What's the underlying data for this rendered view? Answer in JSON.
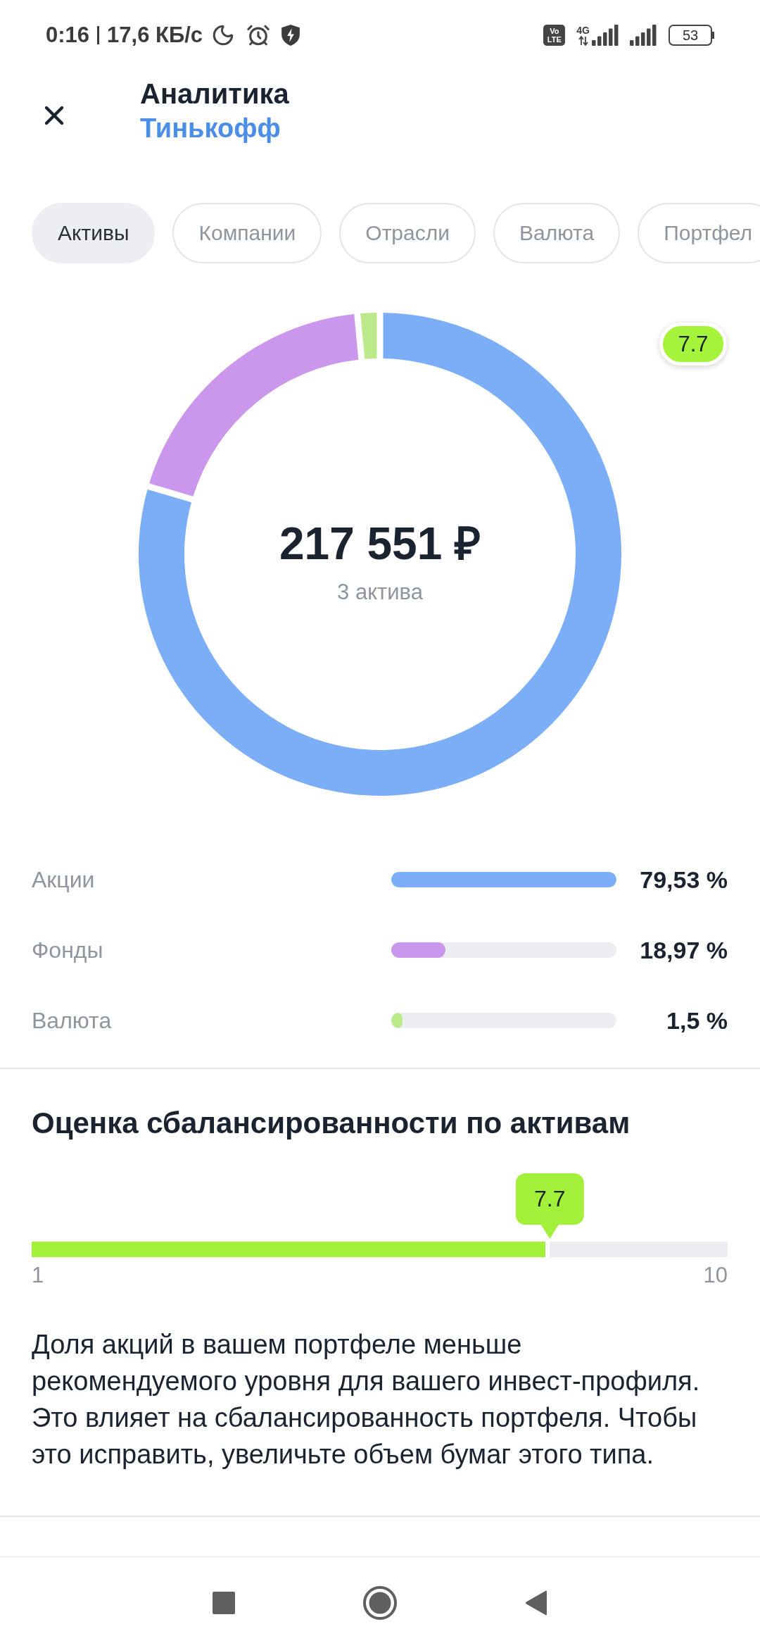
{
  "status_bar": {
    "time": "0:16",
    "speed": "17,6 КБ/с",
    "volte": "Vo LTE",
    "network": "4G",
    "battery": "53"
  },
  "header": {
    "title": "Аналитика",
    "subtitle": "Тинькофф"
  },
  "tabs": [
    {
      "label": "Активы",
      "selected": true
    },
    {
      "label": "Компании",
      "selected": false
    },
    {
      "label": "Отрасли",
      "selected": false
    },
    {
      "label": "Валюта",
      "selected": false
    },
    {
      "label": "Портфел",
      "selected": false
    }
  ],
  "summary": {
    "score_badge": "7.7",
    "total": "217 551 ₽",
    "caption": "3 актива",
    "chart_data": {
      "type": "donut",
      "categories": [
        "Акции",
        "Фонды",
        "Валюта"
      ],
      "values": [
        79.53,
        18.97,
        1.5
      ]
    }
  },
  "assets": [
    {
      "percent": "79,53 %",
      "level": 1,
      "color": "#7caef8"
    },
    {
      "percent": "18,97 %",
      "level": 0.24,
      "color": "#cb97ec"
    },
    {
      "percent": "1,5 %",
      "level": 0.05,
      "color": "#bce98a"
    }
  ],
  "balance": {
    "title": "Оценка сбалансированности по активам",
    "score": "7.7",
    "level": 0.744,
    "min_label": "1",
    "max_label": "10",
    "text": "Доля акций в вашем портфеле меньше рекомендуемого уровня для вашего инвест-профиля. Это влияет на сбалансированность портфеля. Чтобы это исправить, увеличьте объем бумаг этого типа."
  }
}
